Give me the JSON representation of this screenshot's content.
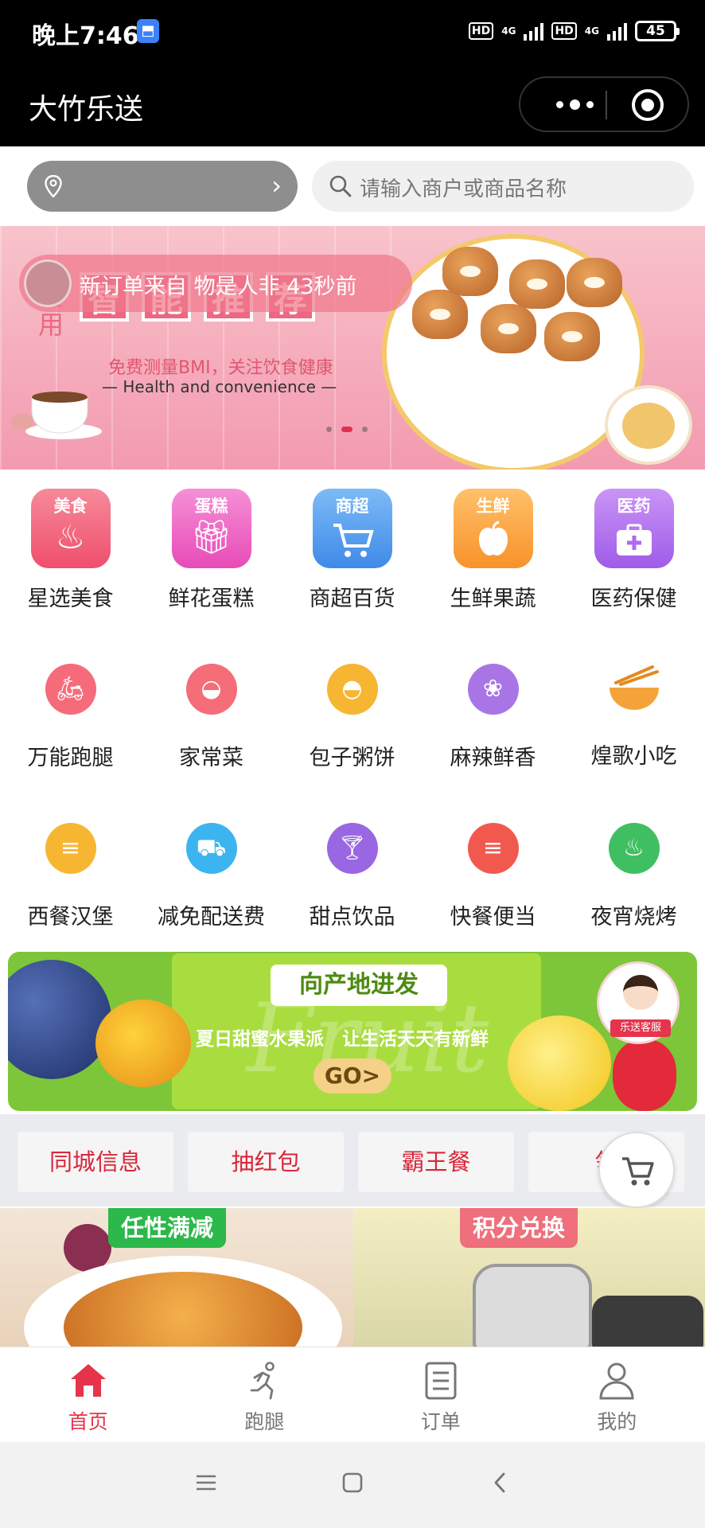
{
  "status_bar": {
    "time": "晚上7:46",
    "hd1": "HD",
    "net1": "4G",
    "hd2": "HD",
    "net2": "4G",
    "battery": "45"
  },
  "title_bar": {
    "title": "大竹乐送"
  },
  "search": {
    "placeholder": "请输入商户或商品名称"
  },
  "banner": {
    "toast": "新订单来自 物是人非 43秒前",
    "headline_chars": [
      "智",
      "能",
      "推",
      "荐"
    ],
    "use_text": "使用",
    "subtitle": "免费测量BMI，关注饮食健康",
    "subtitle_en": "— Health and convenience —"
  },
  "categories_main": [
    {
      "badge": "美食",
      "label": "星选美食",
      "icon": "pot-icon",
      "color": "#f2657e"
    },
    {
      "badge": "蛋糕",
      "label": "鲜花蛋糕",
      "icon": "gift-icon",
      "color": "#f05fc0"
    },
    {
      "badge": "商超",
      "label": "商超百货",
      "icon": "cart-icon",
      "color": "#4c9af0"
    },
    {
      "badge": "生鲜",
      "label": "生鲜果蔬",
      "icon": "apple-icon",
      "color": "#fba33a"
    },
    {
      "badge": "医药",
      "label": "医药保健",
      "icon": "medkit-icon",
      "color": "#b06af0"
    }
  ],
  "categories_row2": [
    {
      "label": "万能跑腿",
      "icon": "scooter-icon",
      "color": "#f56b7a"
    },
    {
      "label": "家常菜",
      "icon": "bowl-icon",
      "color": "#f46d78"
    },
    {
      "label": "包子粥饼",
      "icon": "congee-icon",
      "color": "#f7b632"
    },
    {
      "label": "麻辣鲜香",
      "icon": "salad-icon",
      "color": "#a975e6"
    },
    {
      "label": "煌歌小吃",
      "icon": "noodle-icon",
      "color": "#f4a33b"
    }
  ],
  "categories_row3": [
    {
      "label": "西餐汉堡",
      "icon": "burger-icon",
      "color": "#f7b632"
    },
    {
      "label": "减免配送费",
      "icon": "truck-icon",
      "color": "#3cb4ef"
    },
    {
      "label": "甜点饮品",
      "icon": "cocktail-icon",
      "color": "#9a67e2"
    },
    {
      "label": "快餐便当",
      "icon": "burger-icon",
      "color": "#f2594e"
    },
    {
      "label": "夜宵烧烤",
      "icon": "chicken-icon",
      "color": "#3fbf62"
    }
  ],
  "fruit_banner": {
    "tag": "向产地进发",
    "slogan": "夏日甜蜜水果派　让生活天天有新鲜",
    "go": "GO>",
    "service": "乐送客服",
    "watermark": "Fruit"
  },
  "quick_links": [
    "同城信息",
    "抽红包",
    "霸王餐",
    "领"
  ],
  "promos": [
    {
      "tag": "任性满减"
    },
    {
      "tag": "积分兑换"
    }
  ],
  "tabs": [
    {
      "label": "首页",
      "icon": "home-icon",
      "active": true
    },
    {
      "label": "跑腿",
      "icon": "runner-icon",
      "active": false
    },
    {
      "label": "订单",
      "icon": "order-list-icon",
      "active": false
    },
    {
      "label": "我的",
      "icon": "user-icon",
      "active": false
    }
  ],
  "colors": {
    "accent": "#e5344b",
    "titlebar": "#000000"
  }
}
